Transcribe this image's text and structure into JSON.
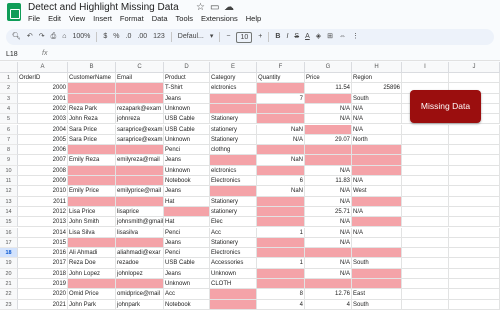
{
  "window": {
    "title": "Detect and Highlight Missing Data"
  },
  "menu": [
    "File",
    "Edit",
    "View",
    "Insert",
    "Format",
    "Data",
    "Tools",
    "Extensions",
    "Help"
  ],
  "toolbar": {
    "zoom": "100%",
    "currency": "$",
    "percent": "%",
    "decimals_dec": ".0",
    "decimals_inc": ".00",
    "number_format": "123",
    "font": "Defaul...",
    "font_size": "10",
    "bold": "B",
    "italic": "I",
    "text_color": "A"
  },
  "formula": {
    "cell_ref": "L18",
    "fx": "fx",
    "content": ""
  },
  "columns": [
    "A",
    "B",
    "C",
    "D",
    "E",
    "F",
    "G",
    "H",
    "I",
    "J"
  ],
  "row_numbers": [
    "1",
    "2",
    "3",
    "4",
    "5",
    "6",
    "7",
    "8",
    "9",
    "10",
    "11",
    "12",
    "13",
    "14",
    "15",
    "16",
    "17",
    "18",
    "19",
    "20",
    "21",
    "22",
    "23"
  ],
  "highlight_row": "18",
  "rows": [
    [
      "OrderID",
      "CustomerName",
      "Email",
      "Product",
      "Category",
      "Quantity",
      "Price",
      "Region"
    ],
    [
      "2000",
      "",
      "",
      "T-Shirt",
      "elctronics",
      "",
      "11.54",
      "25896"
    ],
    [
      "2001",
      "",
      "",
      "Jeans",
      "",
      "7",
      "",
      "South"
    ],
    [
      "2002",
      "Reza Park",
      "rezapark@exam",
      "Unknown",
      "",
      "",
      "N/A",
      "N/A"
    ],
    [
      "2003",
      "John Reza",
      "johnreza",
      "USB Cable",
      "Stationery",
      "",
      "N/A",
      "N/A"
    ],
    [
      "2004",
      "Sara Price",
      "saraprice@exam",
      "USB Cable",
      "stationery",
      "NaN",
      "",
      "N/A"
    ],
    [
      "2005",
      "Sara Price",
      "saraprice@exam",
      "Unknown",
      "Stationery",
      "N/A",
      "29.07",
      "North"
    ],
    [
      "2006",
      "",
      "",
      "Penci",
      "clothng",
      "",
      "",
      ""
    ],
    [
      "2007",
      "Emily Reza",
      "emilyreza@mail",
      "Jeans",
      "",
      "NaN",
      "",
      ""
    ],
    [
      "2008",
      "",
      "",
      "Unknown",
      "elctronics",
      "",
      "N/A",
      ""
    ],
    [
      "2009",
      "",
      "",
      "Notebook",
      "Electronics",
      "6",
      "11.83",
      "N/A"
    ],
    [
      "2010",
      "Emily Price",
      "emilyprice@mail",
      "Jeans",
      "",
      "NaN",
      "N/A",
      "West"
    ],
    [
      "2011",
      "",
      "",
      "Hat",
      "Stationery",
      "",
      "N/A",
      ""
    ],
    [
      "2012",
      "Lisa Price",
      "lisaprice",
      "",
      "stationery",
      "",
      "25.71",
      "N/A"
    ],
    [
      "2013",
      "John Smith",
      "johnsmith@gmail",
      "Hat",
      "Elec",
      "",
      "N/A",
      ""
    ],
    [
      "2014",
      "Lisa Silva",
      "lisasilva",
      "Penci",
      "Acc",
      "1",
      "N/A",
      "N/A"
    ],
    [
      "2015",
      "",
      "",
      "Jeans",
      "Stationery",
      "",
      "N/A",
      ""
    ],
    [
      "2016",
      "Ali Ahmadi",
      "aliahmadi@exar",
      "Penci",
      "Electronics",
      "",
      "",
      ""
    ],
    [
      "2017",
      "Reza Doe",
      "rezadoe",
      "USB Cable",
      "Accessories",
      "1",
      "N/A",
      "South"
    ],
    [
      "2018",
      "John Lopez",
      "johnlopez",
      "Jeans",
      "Unknown",
      "",
      "N/A",
      ""
    ],
    [
      "2019",
      "",
      "",
      "Unknown",
      "CLOTH",
      "",
      "",
      ""
    ],
    [
      "2020",
      "Omid Price",
      "omidprice@mail",
      "Acc",
      "",
      "8",
      "12.76",
      "East"
    ],
    [
      "2021",
      "John Park",
      "johnpark",
      "Notebook",
      "",
      "4",
      "4",
      "South"
    ]
  ],
  "missing_cells": [
    [
      1,
      1
    ],
    [
      1,
      2
    ],
    [
      1,
      5
    ],
    [
      2,
      1
    ],
    [
      2,
      2
    ],
    [
      2,
      4
    ],
    [
      2,
      6
    ],
    [
      3,
      4
    ],
    [
      3,
      5
    ],
    [
      4,
      5
    ],
    [
      5,
      6
    ],
    [
      7,
      1
    ],
    [
      7,
      2
    ],
    [
      7,
      5
    ],
    [
      7,
      6
    ],
    [
      7,
      7
    ],
    [
      8,
      4
    ],
    [
      8,
      6
    ],
    [
      8,
      7
    ],
    [
      9,
      1
    ],
    [
      9,
      2
    ],
    [
      9,
      5
    ],
    [
      9,
      7
    ],
    [
      10,
      1
    ],
    [
      10,
      2
    ],
    [
      11,
      4
    ],
    [
      12,
      1
    ],
    [
      12,
      2
    ],
    [
      12,
      5
    ],
    [
      12,
      7
    ],
    [
      13,
      3
    ],
    [
      13,
      5
    ],
    [
      14,
      5
    ],
    [
      14,
      7
    ],
    [
      16,
      1
    ],
    [
      16,
      2
    ],
    [
      16,
      5
    ],
    [
      17,
      5
    ],
    [
      17,
      6
    ],
    [
      17,
      7
    ],
    [
      19,
      5
    ],
    [
      19,
      7
    ],
    [
      20,
      1
    ],
    [
      20,
      2
    ],
    [
      20,
      5
    ],
    [
      20,
      6
    ],
    [
      20,
      7
    ],
    [
      21,
      4
    ],
    [
      22,
      4
    ]
  ],
  "button": {
    "label": "Missing Data",
    "color": "#9b0e0e"
  },
  "colors": {
    "missing": "#f4a3a8",
    "accent": "#0b57d0"
  }
}
